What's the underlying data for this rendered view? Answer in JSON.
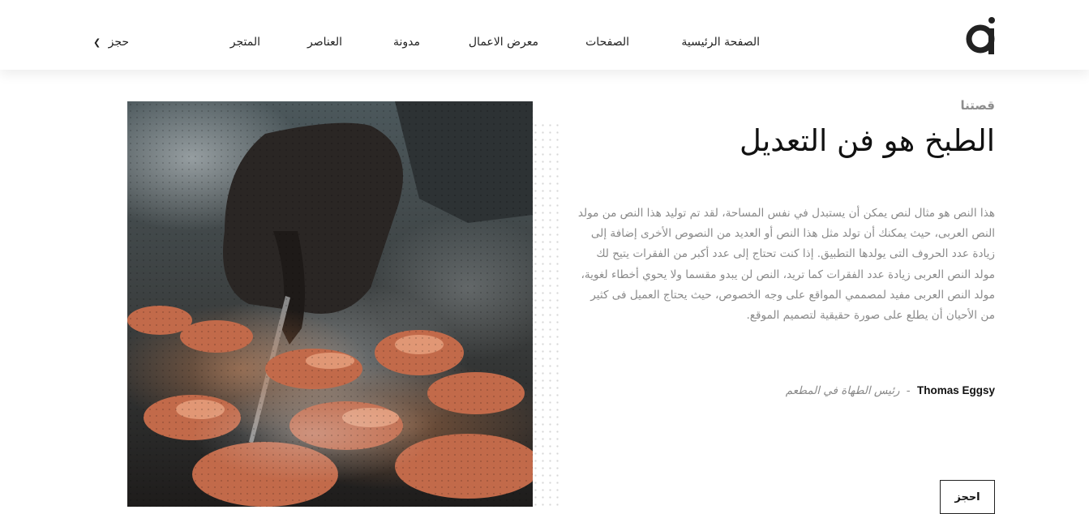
{
  "header": {
    "logo_name": "logo-mark",
    "nav": [
      {
        "label": "الصفحة الرئيسية"
      },
      {
        "label": "الصفحات"
      },
      {
        "label": "معرض الاعمال"
      },
      {
        "label": "مدونة"
      },
      {
        "label": "العناصر"
      },
      {
        "label": "المتجر"
      }
    ],
    "book_link": {
      "label": "حجز",
      "icon": "chevron-left-icon"
    }
  },
  "main": {
    "eyebrow": "قصتنا",
    "title": "الطبخ هو فن التعديل",
    "paragraph": "هذا النص هو مثال لنص يمكن أن يستبدل في نفس المساحة، لقد تم توليد هذا النص من مولد النص العربى، حيث يمكنك أن تولد مثل هذا النص أو العديد من النصوص الأخرى إضافة إلى زيادة عدد الحروف التى يولدها التطبيق. إذا كنت تحتاج إلى عدد أكبر من الفقرات يتيح لك مولد النص العربى زيادة عدد الفقرات كما تريد، النص لن يبدو مقسما ولا يحوي أخطاء لغوية، مولد النص العربى مفيد لمصممي المواقع على وجه الخصوص، حيث يحتاج العميل فى كثير من الأحيان أن يطلع على صورة حقيقية لتصميم الموقع.",
    "signature": {
      "name": "Thomas Eggsy",
      "separator": "-",
      "role": "رئيس الطهاة في المطعم"
    },
    "button_label": "احجز"
  },
  "colors": {
    "text": "#222222",
    "muted": "#8a8a8a",
    "background": "#ffffff"
  }
}
